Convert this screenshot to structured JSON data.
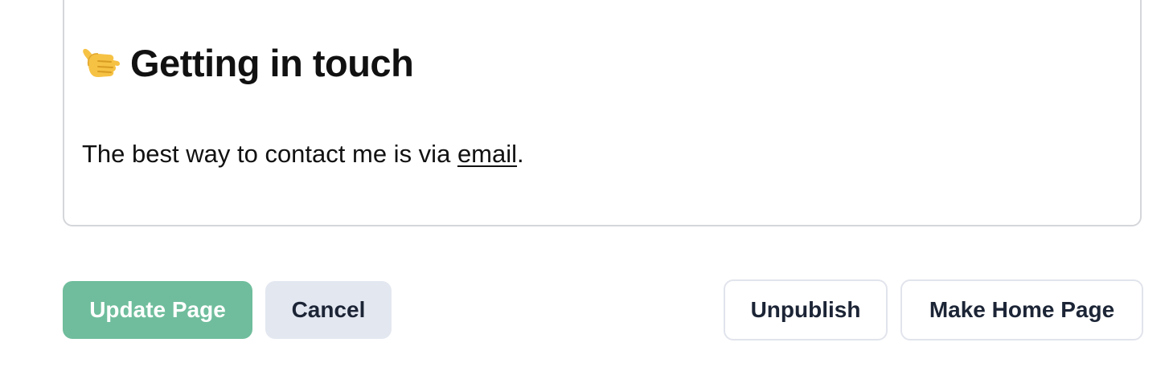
{
  "content": {
    "heading_emoji": "call-me-hand-emoji",
    "heading_text": "Getting in touch",
    "body_prefix": "The best way to contact me is via ",
    "body_link": "email",
    "body_suffix": "."
  },
  "actions": {
    "update_label": "Update Page",
    "cancel_label": "Cancel",
    "unpublish_label": "Unpublish",
    "make_home_label": "Make Home Page"
  },
  "colors": {
    "primary": "#6fbd9c",
    "secondary": "#e3e7f0",
    "outline_border": "#e1e4ec",
    "text": "#111111"
  }
}
